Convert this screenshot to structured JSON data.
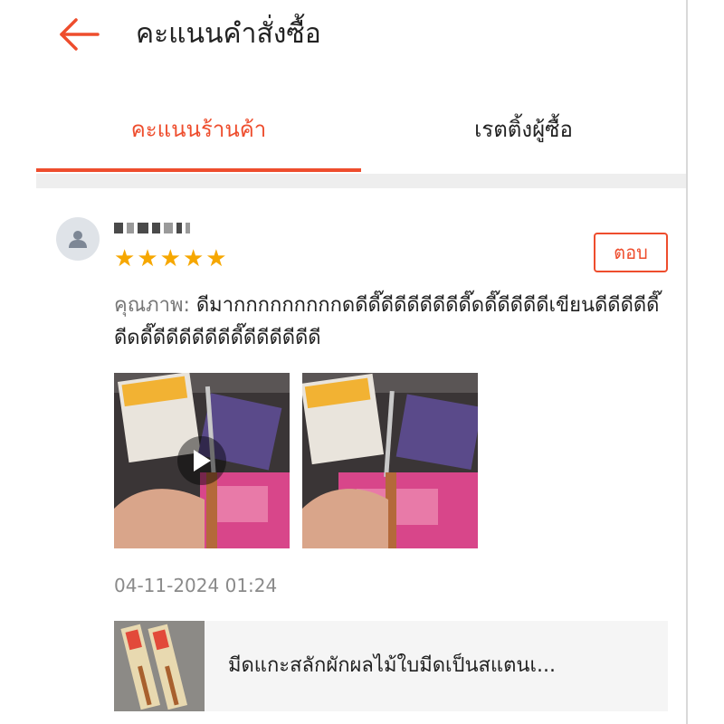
{
  "header": {
    "back_icon": "arrow-left-icon",
    "title": "คะแนนคำสั่งซื้อ"
  },
  "tabs": [
    {
      "label": "คะแนนร้านค้า",
      "active": true
    },
    {
      "label": "เรตติ้งผู้ซื้อ",
      "active": false
    }
  ],
  "colors": {
    "accent": "#ee4d2d",
    "star": "#f6a700",
    "muted_text": "#8a8a8a"
  },
  "review": {
    "avatar_icon": "user-icon",
    "username_obscured": true,
    "rating": 5,
    "max_rating": 5,
    "reply_label": "ตอบ",
    "quality_label": "คุณภาพ:",
    "text": " ดีมากกกกกกกกกดดีดี๊ดีดีดีดีดีดีดี๊ดดี๊ดีดีดีดีเขียนดีดีดีดีดี๊ดีดดี๊ดีดีดีดีดีดีดี๊ดีดีดีดีดีดี",
    "media": [
      {
        "type": "video",
        "icon": "play-icon"
      },
      {
        "type": "photo"
      }
    ],
    "timestamp": "04-11-2024 01:24"
  },
  "product": {
    "name": "มีดแกะสลักผักผลไม้ใบมีดเป็นสแตนเ..."
  }
}
